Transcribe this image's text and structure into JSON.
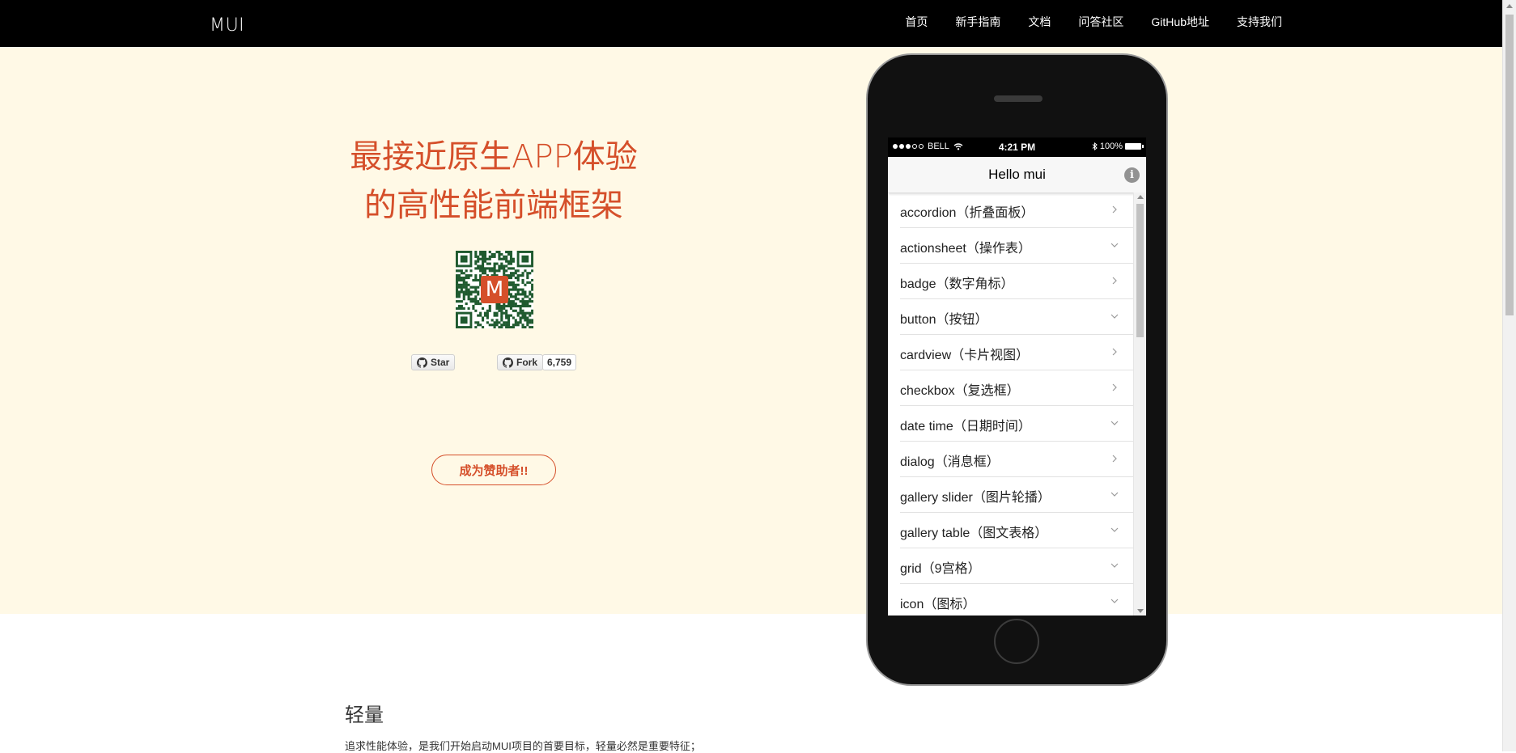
{
  "nav": {
    "brand": "MUI",
    "links": [
      "首页",
      "新手指南",
      "文档",
      "问答社区",
      "GitHub地址",
      "支持我们"
    ]
  },
  "hero": {
    "title_line1": "最接近原生APP体验",
    "title_line2": "的高性能前端框架",
    "qr_logo": "M",
    "star_label": "Star",
    "fork_label": "Fork",
    "fork_count": "6,759",
    "sponsor_label": "成为赞助者!!"
  },
  "phone": {
    "status": {
      "carrier": "BELL",
      "time": "4:21 PM",
      "battery": "100%"
    },
    "header_title": "Hello mui",
    "info_glyph": "i",
    "items": [
      {
        "label": "accordion（折叠面板）",
        "chevron": "right"
      },
      {
        "label": "actionsheet（操作表）",
        "chevron": "down"
      },
      {
        "label": "badge（数字角标）",
        "chevron": "right"
      },
      {
        "label": "button（按钮）",
        "chevron": "down"
      },
      {
        "label": "cardview（卡片视图）",
        "chevron": "right"
      },
      {
        "label": "checkbox（复选框）",
        "chevron": "right"
      },
      {
        "label": "date time（日期时间）",
        "chevron": "down"
      },
      {
        "label": "dialog（消息框）",
        "chevron": "right"
      },
      {
        "label": "gallery slider（图片轮播）",
        "chevron": "down"
      },
      {
        "label": "gallery table（图文表格）",
        "chevron": "down"
      },
      {
        "label": "grid（9宫格）",
        "chevron": "down"
      },
      {
        "label": "icon（图标）",
        "chevron": "down"
      }
    ]
  },
  "content": {
    "section_title": "轻量",
    "section_text": "追求性能体验，是我们开始启动MUI项目的首要目标，轻量必然是重要特征；"
  },
  "colors": {
    "accent": "#d54f2a",
    "hero_bg": "#fff9e6",
    "nav_bg": "#000000"
  }
}
